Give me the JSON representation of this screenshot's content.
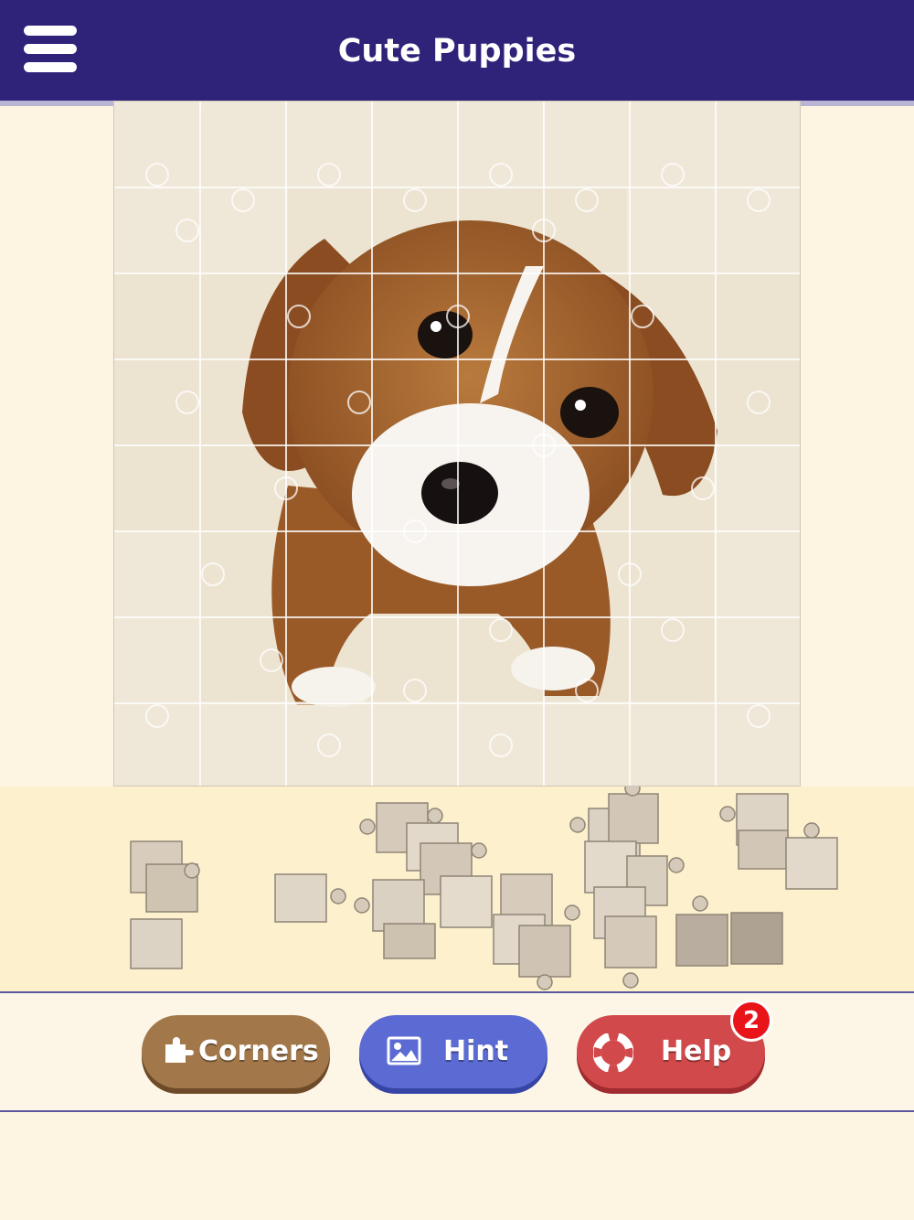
{
  "header": {
    "title": "Cute Puppies",
    "menu_icon": "hamburger-menu-icon",
    "background_color": "#2e2279"
  },
  "puzzle": {
    "grid_columns": 8,
    "grid_rows": 8,
    "image_subject": "puppy",
    "unplaced_pieces_in_tray": 26
  },
  "buttons": {
    "corners": {
      "label": "Corners",
      "icon": "puzzle-piece-icon",
      "color": "#a2784b"
    },
    "hint": {
      "label": "Hint",
      "icon": "image-icon",
      "color": "#5b6bd3"
    },
    "help": {
      "label": "Help",
      "icon": "lifebuoy-icon",
      "color": "#d2494b",
      "badge_count": "2"
    }
  }
}
